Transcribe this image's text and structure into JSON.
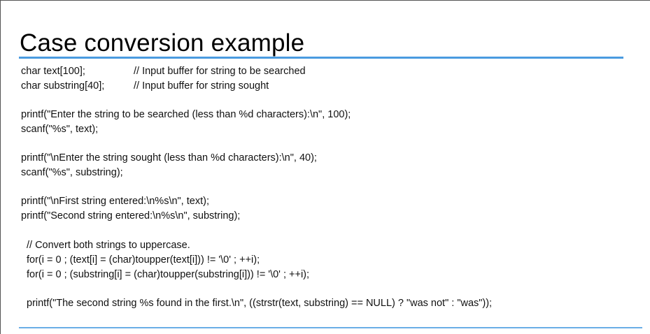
{
  "slide": {
    "title": "Case conversion example"
  },
  "code": {
    "decl_text": "char text[100];",
    "decl_text_comment": "// Input buffer for string to be searched",
    "decl_substring": "char substring[40];",
    "decl_substring_comment": "// Input buffer for string sought",
    "printf_enter_string": "printf(\"Enter the string to be searched (less than %d characters):\\n\", 100);",
    "scanf_text": "scanf(\"%s\", text);",
    "printf_enter_sought": "printf(\"\\nEnter the string sought (less than %d characters):\\n\", 40);",
    "scanf_substring": "scanf(\"%s\", substring);",
    "printf_first_entered": "printf(\"\\nFirst string entered:\\n%s\\n\", text);",
    "printf_second_entered": "printf(\"Second string entered:\\n%s\\n\", substring);",
    "comment_convert": "// Convert both strings to uppercase.",
    "for_text": "for(i = 0 ; (text[i] = (char)toupper(text[i])) != '\\0' ; ++i);",
    "for_substring": "for(i = 0 ; (substring[i] = (char)toupper(substring[i])) != '\\0' ; ++i);",
    "printf_result": "printf(\"The second string %s found in the first.\\n\", ((strstr(text, substring) == NULL) ? \"was not\" : \"was\"));"
  },
  "colors": {
    "accent_rule": "#4a9be0",
    "bottom_rule": "#6aaee6"
  }
}
